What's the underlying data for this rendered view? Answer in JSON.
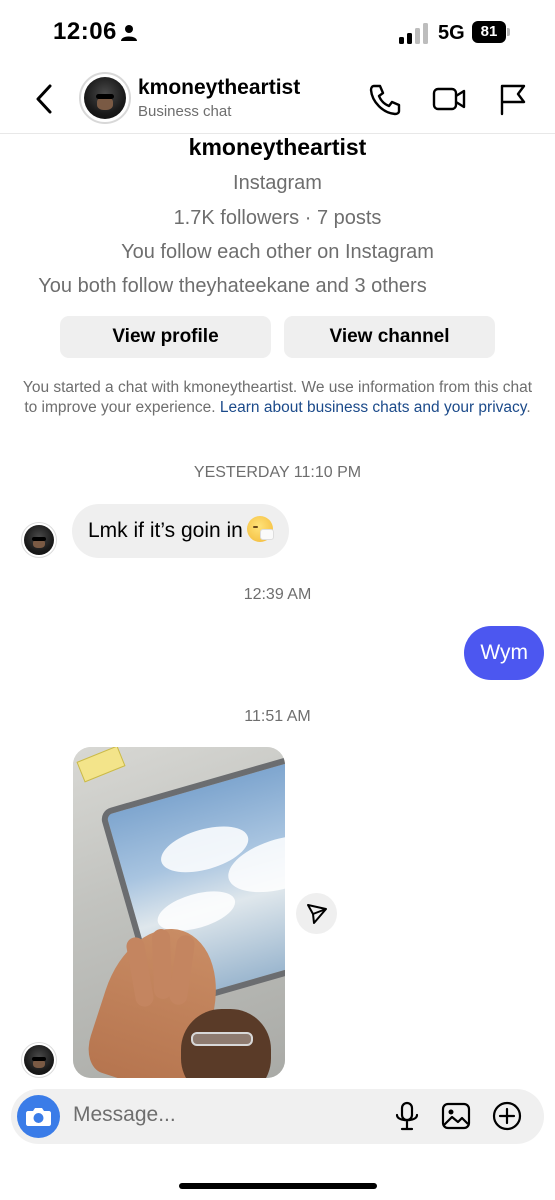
{
  "status_bar": {
    "time": "12:06",
    "network": "5G",
    "battery": "81",
    "icons": [
      "person-icon",
      "signal-icon",
      "battery-icon"
    ]
  },
  "header": {
    "name": "kmoneytheartist",
    "subtitle": "Business chat",
    "icons": [
      "back-chevron-icon",
      "phone-icon",
      "video-camera-icon",
      "flag-icon"
    ]
  },
  "profile": {
    "name": "kmoneytheartist",
    "platform": "Instagram",
    "stats": "1.7K followers · 7 posts",
    "mutual": "You follow each other on Instagram",
    "both_follow": "You both follow theyhateekane and 3 others",
    "view_profile_label": "View profile",
    "view_channel_label": "View channel"
  },
  "notice": {
    "text": "You started a chat with kmoneytheartist. We use information from this chat to improve your experience. ",
    "link": "Learn about business chats and your privacy",
    "suffix": "."
  },
  "messages": [
    {
      "timestamp": "YESTERDAY 11:10 PM",
      "from": "them",
      "text": "Lmk if it’s goin in",
      "emoji": "sneezing-face-emoji"
    },
    {
      "timestamp": "12:39 AM",
      "from": "me",
      "text": "Wym"
    },
    {
      "timestamp": "11:51 AM",
      "from": "them",
      "media": "photo"
    }
  ],
  "composer": {
    "placeholder": "Message...",
    "icons": [
      "camera-icon",
      "microphone-icon",
      "image-icon",
      "plus-icon"
    ]
  },
  "colors": {
    "accent": "#4c57f0",
    "camera_button": "#3a7ce8",
    "incoming_bubble": "#efefef",
    "link": "#1b4a8a",
    "muted_text": "#6e6e6e"
  }
}
